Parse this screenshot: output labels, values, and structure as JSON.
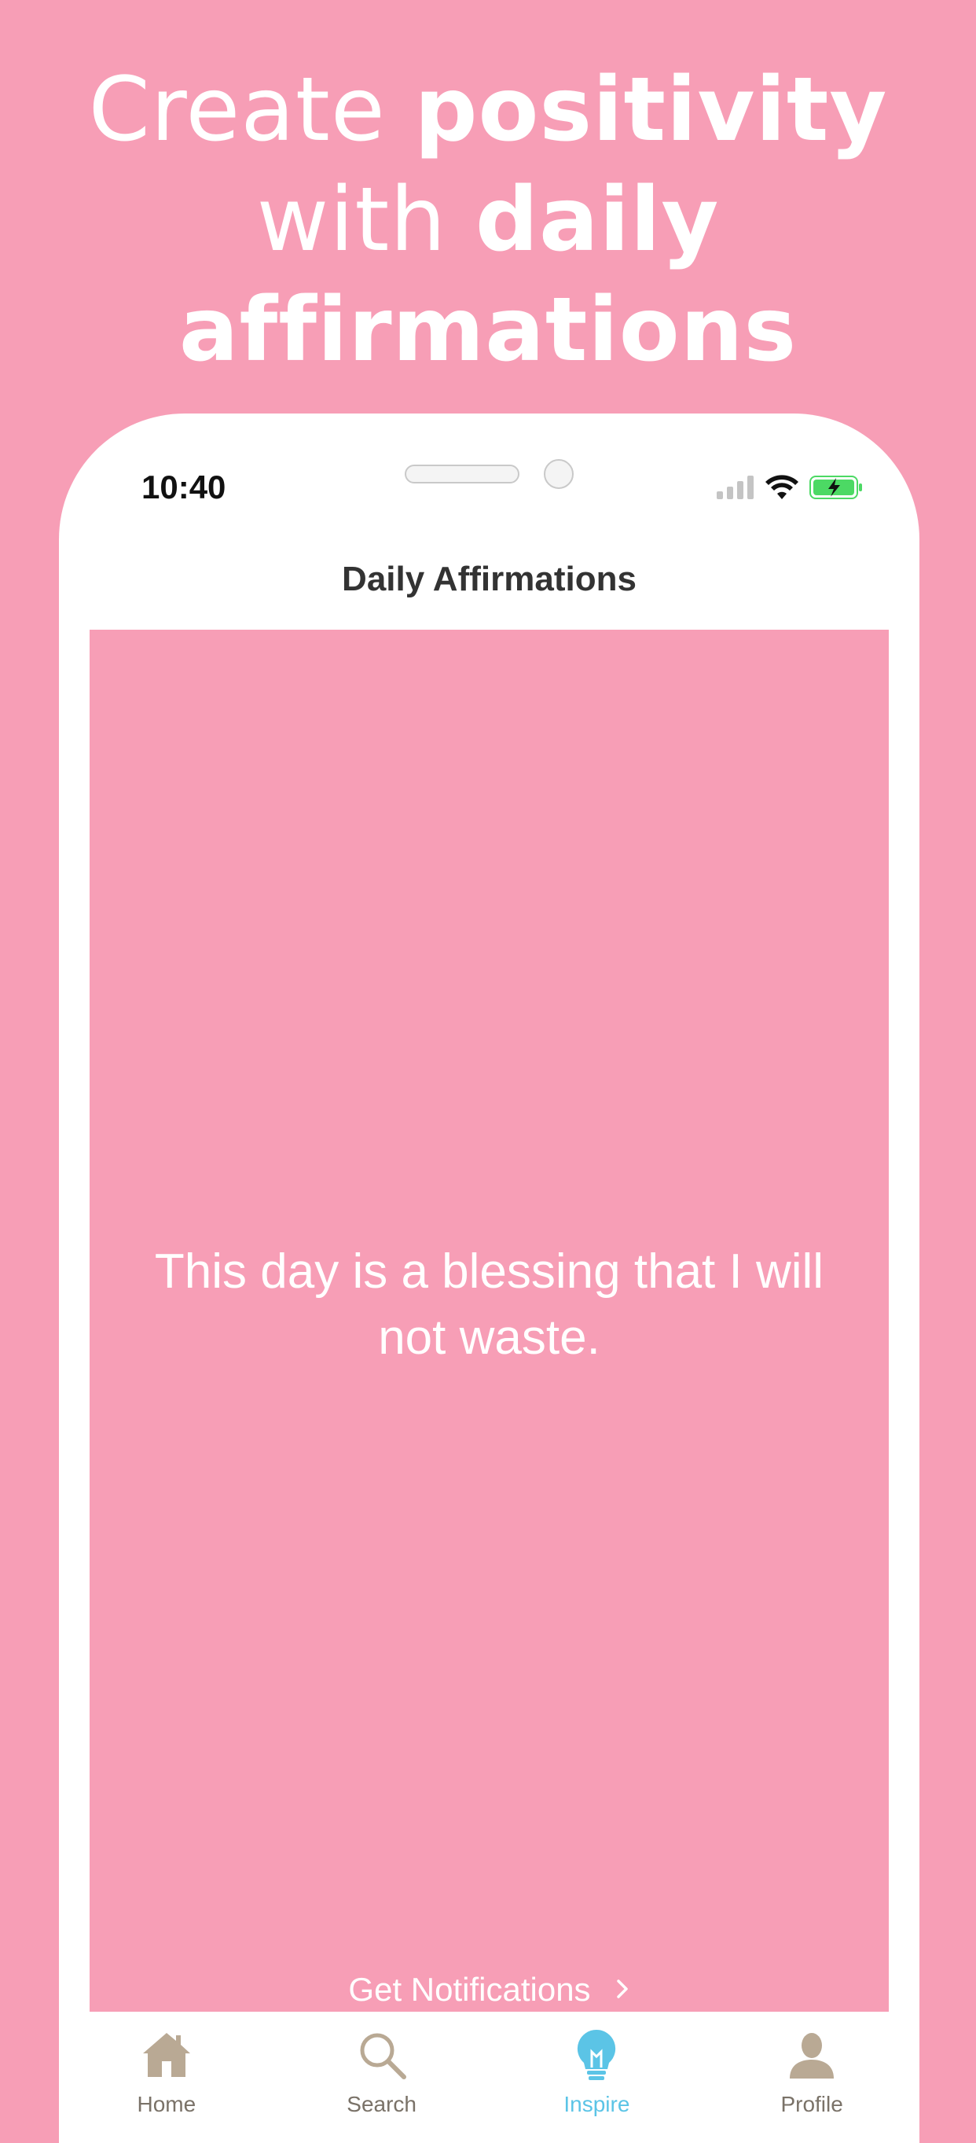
{
  "headline": {
    "line1_light": "Create ",
    "line1_bold": "positivity",
    "line2_light": "with ",
    "line2_bold": "daily",
    "line3_bold": "affirmations"
  },
  "status_bar": {
    "time": "10:40",
    "icons": [
      "signal-icon",
      "wifi-icon",
      "battery-charging-icon"
    ]
  },
  "nav": {
    "title": "Daily Affirmations"
  },
  "affirmation": {
    "text": "This day is a blessing that I will not waste."
  },
  "notifications_button": {
    "label": "Get Notifications"
  },
  "tabs": [
    {
      "label": "Home",
      "icon": "home-icon"
    },
    {
      "label": "Search",
      "icon": "search-icon"
    },
    {
      "label": "Inspire",
      "icon": "lightbulb-icon",
      "active": true
    },
    {
      "label": "Profile",
      "icon": "profile-icon"
    }
  ],
  "colors": {
    "background": "#F79EB6",
    "card": "#F79EB6",
    "tab_active": "#5BC4E6",
    "tab_inactive_icon": "#B9A994",
    "battery": "#4CD964"
  }
}
